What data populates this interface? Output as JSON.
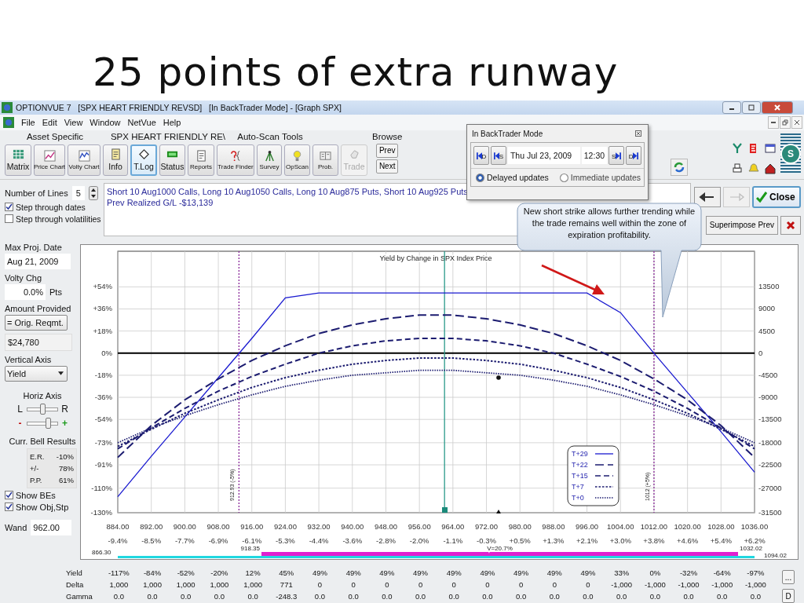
{
  "slide_title": "25 points of extra runway",
  "window": {
    "title": "OPTIONVUE 7   [SPX HEART FRIENDLY REVSD]   [In BackTrader Mode] - [Graph SPX]"
  },
  "menu": [
    "File",
    "Edit",
    "View",
    "Window",
    "NetVue",
    "Help"
  ],
  "toolbar": {
    "groups": [
      "Asset Specific",
      "SPX HEART FRIENDLY RE\\",
      "Auto-Scan Tools"
    ],
    "buttons": [
      {
        "label": "Matrix",
        "selected": false,
        "disabled": false
      },
      {
        "label": "Price Chart",
        "selected": false,
        "disabled": false
      },
      {
        "label": "Volty Chart",
        "selected": false,
        "disabled": false
      },
      {
        "label": "Info",
        "selected": false,
        "disabled": false
      },
      {
        "label": "T.Log",
        "selected": true,
        "disabled": false
      },
      {
        "label": "Status",
        "selected": false,
        "disabled": false
      },
      {
        "label": "Reports",
        "selected": false,
        "disabled": false
      },
      {
        "label": "Trade Finder",
        "selected": false,
        "disabled": false
      },
      {
        "label": "Survey",
        "selected": false,
        "disabled": false
      },
      {
        "label": "OpScan",
        "selected": false,
        "disabled": false
      },
      {
        "label": "Prob.",
        "selected": false,
        "disabled": false
      },
      {
        "label": "Trade",
        "selected": false,
        "disabled": true
      }
    ],
    "browse": {
      "label": "Browse",
      "buttons": [
        "Prev",
        "Next"
      ]
    },
    "logo_letter": "S"
  },
  "backtrader_dialog": {
    "title": "In BackTrader Mode",
    "step_buttons": [
      {
        "label": "D",
        "kind": "back"
      },
      {
        "label": "S",
        "kind": "back"
      },
      {
        "label": "S",
        "kind": "forward"
      },
      {
        "label": "D",
        "kind": "forward"
      }
    ],
    "date": "Thu Jul 23, 2009",
    "time": "12:30",
    "update_modes": [
      {
        "label": "Delayed updates",
        "selected": true
      },
      {
        "label": "Immediate updates",
        "selected": false
      }
    ]
  },
  "position_info": {
    "lines": [
      "Short 10 Aug1000 Calls, Long 10 Aug1050 Calls, Long 10 Aug875 Puts, Short 10 Aug925 Puts",
      "Prev Realized G/L -$13,139"
    ]
  },
  "nav_arrows": [
    {
      "disabled": false
    },
    {
      "disabled": true
    }
  ],
  "close_button": "Close",
  "superimpose_button": "Superimpose Prev",
  "callout": {
    "text": "New short strike allows further trending while the trade remains well within the zone of expiration profitability."
  },
  "left_panel": {
    "lines_label": "Number of Lines",
    "lines_value": "5",
    "options": [
      {
        "label": "Step through dates",
        "checked": true
      },
      {
        "label": "Step through volatilities",
        "checked": false
      }
    ],
    "max_date_label": "Max Proj. Date",
    "max_date": "Aug 21, 2009",
    "volty_label": "Volty Chg",
    "volty_value": "0.0%",
    "volty_unit": "Pts",
    "amount_label": "Amount Provided",
    "amount_choice": "= Orig. Reqmt.",
    "amount_value": "$24,780",
    "vaxis_label": "Vertical Axis",
    "vaxis_choice": "Yield",
    "haxis_label": "Horiz Axis",
    "sliders": [
      {
        "left": "L",
        "right": "R",
        "level": 0.5
      },
      {
        "left": "-",
        "right": "+",
        "level": 0.65
      }
    ],
    "bell_label": "Curr. Bell Results",
    "bell_results": [
      {
        "name": "E.R.",
        "value": "-10%"
      },
      {
        "name": "+/-",
        "value": "78%"
      },
      {
        "name": "P.P.",
        "value": "61%"
      }
    ],
    "show_options": [
      {
        "label": "Show BEs",
        "checked": true
      },
      {
        "label": "Show Obj,Stp",
        "checked": true
      }
    ],
    "wand_label": "Wand",
    "wand_value": "962.00"
  },
  "chart": {
    "chart_data": {
      "type": "line",
      "title": "Yield by Change in SPX Index Price",
      "x": [
        884,
        892,
        900,
        908,
        916,
        924,
        932,
        940,
        948,
        956,
        964,
        972,
        980,
        988,
        996,
        1004,
        1012,
        1020,
        1028,
        1036
      ],
      "series": [
        {
          "name": "T+29",
          "color": "#1a1ad0",
          "line_style": "solid",
          "values": [
            -117,
            -84,
            -52,
            -20,
            12,
            45,
            49,
            49,
            49,
            49,
            49,
            49,
            49,
            49,
            49,
            33,
            0,
            -32,
            -64,
            -97
          ]
        },
        {
          "name": "T+22",
          "color": "#1c1c70",
          "line_style": "loosely dashed",
          "values": [
            -85,
            -59,
            -38,
            -21,
            -6,
            6,
            16,
            23,
            28,
            31,
            31,
            28,
            23,
            16,
            6,
            -6,
            -21,
            -38,
            -59,
            -85
          ]
        },
        {
          "name": "T+15",
          "color": "#1c1c70",
          "line_style": "dashed",
          "values": [
            -78,
            -61,
            -45,
            -31,
            -19,
            -9,
            0,
            6,
            10,
            12,
            12,
            10,
            6,
            0,
            -9,
            -19,
            -31,
            -45,
            -61,
            -78
          ]
        },
        {
          "name": "T+7",
          "color": "#1c1c70",
          "line_style": "dotted",
          "values": [
            -76,
            -62,
            -49,
            -38,
            -28,
            -20,
            -14,
            -9,
            -6,
            -4,
            -4,
            -6,
            -9,
            -14,
            -20,
            -28,
            -38,
            -49,
            -62,
            -76
          ]
        },
        {
          "name": "T+0",
          "color": "#1c1c70",
          "line_style": "densely dotted",
          "values": [
            -73,
            -61,
            -51,
            -42,
            -34,
            -27,
            -22,
            -18,
            -16,
            -14,
            -14,
            -16,
            -18,
            -22,
            -27,
            -34,
            -42,
            -51,
            -61,
            -73
          ]
        }
      ],
      "xlim": [
        884,
        1036
      ],
      "ylim": [
        -130,
        83
      ],
      "grid": true,
      "legend": "lower right",
      "xticks": [
        {
          "value": 884,
          "label": "884.00"
        },
        {
          "value": 892,
          "label": "892.00"
        },
        {
          "value": 900,
          "label": "900.00"
        },
        {
          "value": 908,
          "label": "908.00"
        },
        {
          "value": 916,
          "label": "916.00"
        },
        {
          "value": 924,
          "label": "924.00"
        },
        {
          "value": 932,
          "label": "932.00"
        },
        {
          "value": 940,
          "label": "940.00"
        },
        {
          "value": 948,
          "label": "948.00"
        },
        {
          "value": 956,
          "label": "956.00"
        },
        {
          "value": 964,
          "label": "964.00"
        },
        {
          "value": 972,
          "label": "972.00"
        },
        {
          "value": 980,
          "label": "980.00"
        },
        {
          "value": 988,
          "label": "988.00"
        },
        {
          "value": 996,
          "label": "996.00"
        },
        {
          "value": 1004,
          "label": "1004.00"
        },
        {
          "value": 1012,
          "label": "1012.00"
        },
        {
          "value": 1020,
          "label": "1020.00"
        },
        {
          "value": 1028,
          "label": "1028.00"
        },
        {
          "value": 1036,
          "label": "1036.00"
        }
      ],
      "yticks": [
        {
          "value": 54,
          "label": "+54%"
        },
        {
          "value": 36,
          "label": "+36%"
        },
        {
          "value": 18,
          "label": "+18%"
        },
        {
          "value": 0,
          "label": "0%"
        },
        {
          "value": -18,
          "label": "-18%"
        },
        {
          "value": -36,
          "label": "-36%"
        },
        {
          "value": -54,
          "label": "-54%"
        },
        {
          "value": -73,
          "label": "-73%"
        },
        {
          "value": -91,
          "label": "-91%"
        },
        {
          "value": -110,
          "label": "-110%"
        },
        {
          "value": -130,
          "label": "-130%"
        }
      ],
      "ref_lines": [
        {
          "axis": "x",
          "value": 912.93,
          "label": "912.93 (-5%)",
          "color": "#8a2a9a"
        },
        {
          "axis": "x",
          "value": 1012,
          "label": "1012 (+5%)",
          "color": "#8a2a9a"
        },
        {
          "axis": "x",
          "value": 962,
          "color": "#2a9a8a"
        }
      ]
    },
    "bell_bar_label": "V=20.7%",
    "right_axis_labels": [
      "13500",
      "9000",
      "4500",
      "0",
      "-4500",
      "-9000",
      "-13500",
      "-18000",
      "-22500",
      "-27000",
      "-31500"
    ],
    "x_change_labels": [
      "-9.4%",
      "-8.5%",
      "-7.7%",
      "-6.9%",
      "-6.1%",
      "-5.3%",
      "-4.4%",
      "-3.6%",
      "-2.8%",
      "-2.0%",
      "-1.1%",
      "-0.3%",
      "+0.5%",
      "+1.3%",
      "+2.1%",
      "+3.0%",
      "+3.8%",
      "+4.6%",
      "+5.4%",
      "+6.2%"
    ],
    "bell_labels": [
      "866.30",
      "918.35",
      "1032.02",
      "1094.02"
    ]
  },
  "greeks_table": {
    "rows": [
      {
        "label": "Yield",
        "values": [
          "-117%",
          "-84%",
          "-52%",
          "-20%",
          "12%",
          "45%",
          "49%",
          "49%",
          "49%",
          "49%",
          "49%",
          "49%",
          "49%",
          "49%",
          "49%",
          "33%",
          "0%",
          "-32%",
          "-64%",
          "-97%"
        ]
      },
      {
        "label": "Delta",
        "values": [
          "1,000",
          "1,000",
          "1,000",
          "1,000",
          "1,000",
          "771",
          "0",
          "0",
          "0",
          "0",
          "0",
          "0",
          "0",
          "0",
          "0",
          "-1,000",
          "-1,000",
          "-1,000",
          "-1,000",
          "-1,000"
        ]
      },
      {
        "label": "Gamma",
        "values": [
          "0.0",
          "0.0",
          "0.0",
          "0.0",
          "0.0",
          "-248.3",
          "0.0",
          "0.0",
          "0.0",
          "0.0",
          "0.0",
          "0.0",
          "0.0",
          "0.0",
          "0.0",
          "0.0",
          "0.0",
          "0.0",
          "0.0",
          "0.0"
        ]
      }
    ],
    "buttons": [
      "...",
      "D"
    ]
  }
}
